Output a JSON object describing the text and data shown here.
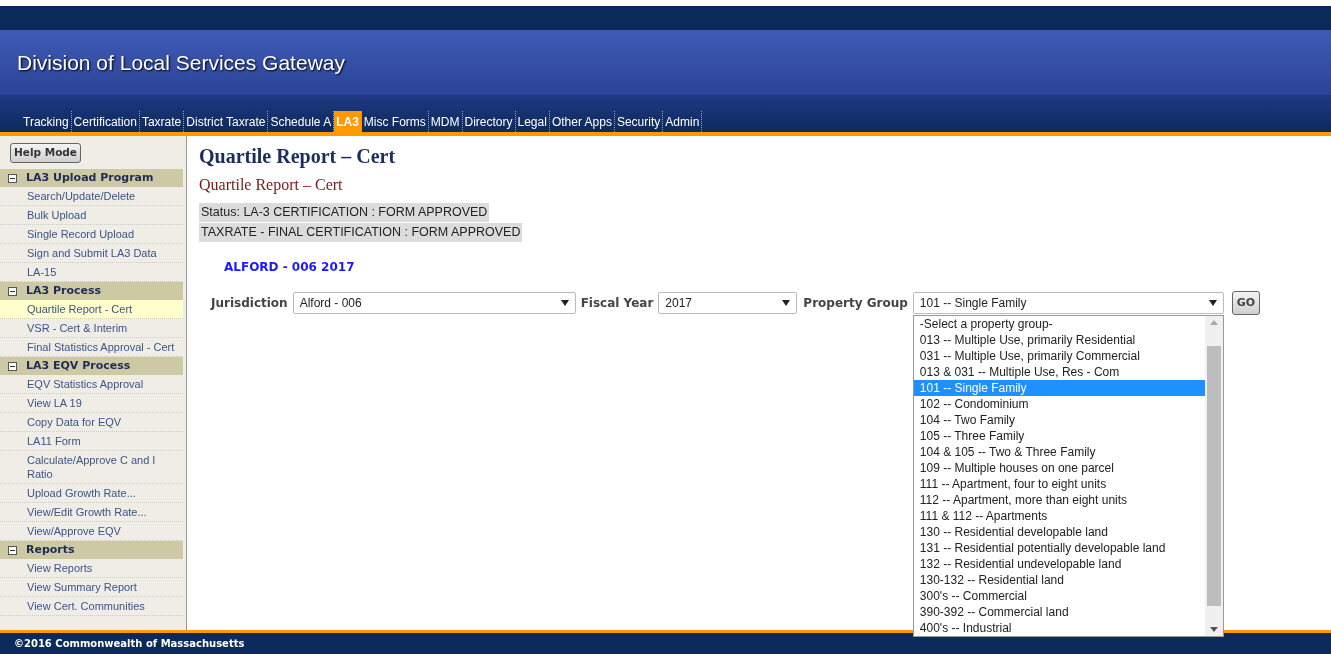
{
  "header": {
    "title": "Division of Local Services Gateway"
  },
  "nav_tabs": [
    {
      "label": "Tracking",
      "selected": false
    },
    {
      "label": "Certification",
      "selected": false
    },
    {
      "label": "Taxrate",
      "selected": false
    },
    {
      "label": "District Taxrate",
      "selected": false
    },
    {
      "label": "Schedule A",
      "selected": false
    },
    {
      "label": "LA3",
      "selected": true
    },
    {
      "label": "Misc Forms",
      "selected": false
    },
    {
      "label": "MDM",
      "selected": false
    },
    {
      "label": "Directory",
      "selected": false
    },
    {
      "label": "Legal",
      "selected": false
    },
    {
      "label": "Other Apps",
      "selected": false
    },
    {
      "label": "Security",
      "selected": false
    },
    {
      "label": "Admin",
      "selected": false
    }
  ],
  "help_button": "Help Mode",
  "sidebar": {
    "sections": [
      {
        "title": "LA3 Upload Program",
        "expanded": true,
        "items": [
          {
            "label": "Search/Update/Delete",
            "selected": false
          },
          {
            "label": "Bulk Upload",
            "selected": false
          },
          {
            "label": "Single Record Upload",
            "selected": false
          },
          {
            "label": "Sign and Submit LA3 Data",
            "selected": false
          },
          {
            "label": "LA-15",
            "selected": false
          }
        ]
      },
      {
        "title": "LA3 Process",
        "expanded": true,
        "items": [
          {
            "label": "Quartile Report - Cert",
            "selected": true
          },
          {
            "label": "VSR - Cert & Interim",
            "selected": false
          },
          {
            "label": "Final Statistics Approval - Cert",
            "selected": false
          }
        ]
      },
      {
        "title": "LA3 EQV Process",
        "expanded": true,
        "items": [
          {
            "label": "EQV Statistics Approval",
            "selected": false
          },
          {
            "label": "View LA 19",
            "selected": false
          },
          {
            "label": "Copy Data for EQV",
            "selected": false
          },
          {
            "label": "LA11 Form",
            "selected": false
          },
          {
            "label": "Calculate/Approve C and I Ratio",
            "selected": false
          },
          {
            "label": "Upload Growth Rate...",
            "selected": false
          },
          {
            "label": "View/Edit Growth Rate...",
            "selected": false
          },
          {
            "label": "View/Approve EQV",
            "selected": false
          }
        ]
      },
      {
        "title": "Reports",
        "expanded": true,
        "items": [
          {
            "label": "View Reports",
            "selected": false
          },
          {
            "label": "View Summary Report",
            "selected": false
          },
          {
            "label": "View Cert. Communities",
            "selected": false
          }
        ]
      }
    ]
  },
  "page_title": "Quartile Report – Cert",
  "subtitle": "Quartile Report – Cert",
  "status_lines": [
    "Status: LA-3 CERTIFICATION : FORM APPROVED",
    "TAXRATE - FINAL CERTIFICATION : FORM APPROVED"
  ],
  "jurisdiction_heading": "ALFORD - 006 2017",
  "filters": {
    "jurisdiction": {
      "label": "Jurisdiction",
      "value": "Alford - 006"
    },
    "fiscal_year": {
      "label": "Fiscal Year",
      "value": "2017"
    },
    "property_group": {
      "label": "Property Group",
      "value": "101 -- Single Family",
      "expanded": true,
      "options": [
        {
          "label": "-Select a property group-",
          "selected": false
        },
        {
          "label": "013 -- Multiple Use, primarily Residential",
          "selected": false
        },
        {
          "label": "031 -- Multiple Use, primarily Commercial",
          "selected": false
        },
        {
          "label": "013 & 031 -- Multiple Use, Res - Com",
          "selected": false
        },
        {
          "label": "101 -- Single Family",
          "selected": true
        },
        {
          "label": "102 -- Condominium",
          "selected": false
        },
        {
          "label": "104 -- Two Family",
          "selected": false
        },
        {
          "label": "105 -- Three Family",
          "selected": false
        },
        {
          "label": "104 & 105 -- Two & Three Family",
          "selected": false
        },
        {
          "label": "109 -- Multiple houses on one parcel",
          "selected": false
        },
        {
          "label": "111 -- Apartment, four to eight units",
          "selected": false
        },
        {
          "label": "112 -- Apartment, more than eight units",
          "selected": false
        },
        {
          "label": "111 & 112 -- Apartments",
          "selected": false
        },
        {
          "label": "130 -- Residential developable land",
          "selected": false
        },
        {
          "label": "131 -- Residential potentially developable land",
          "selected": false
        },
        {
          "label": "132 -- Residential undevelopable land",
          "selected": false
        },
        {
          "label": "130-132 -- Residential land",
          "selected": false
        },
        {
          "label": "300's -- Commercial",
          "selected": false
        },
        {
          "label": "390-392 -- Commercial land",
          "selected": false
        },
        {
          "label": "400's -- Industrial",
          "selected": false
        }
      ]
    },
    "go_button": "GO"
  },
  "footer": "©2016 Commonwealth of Massachusetts"
}
